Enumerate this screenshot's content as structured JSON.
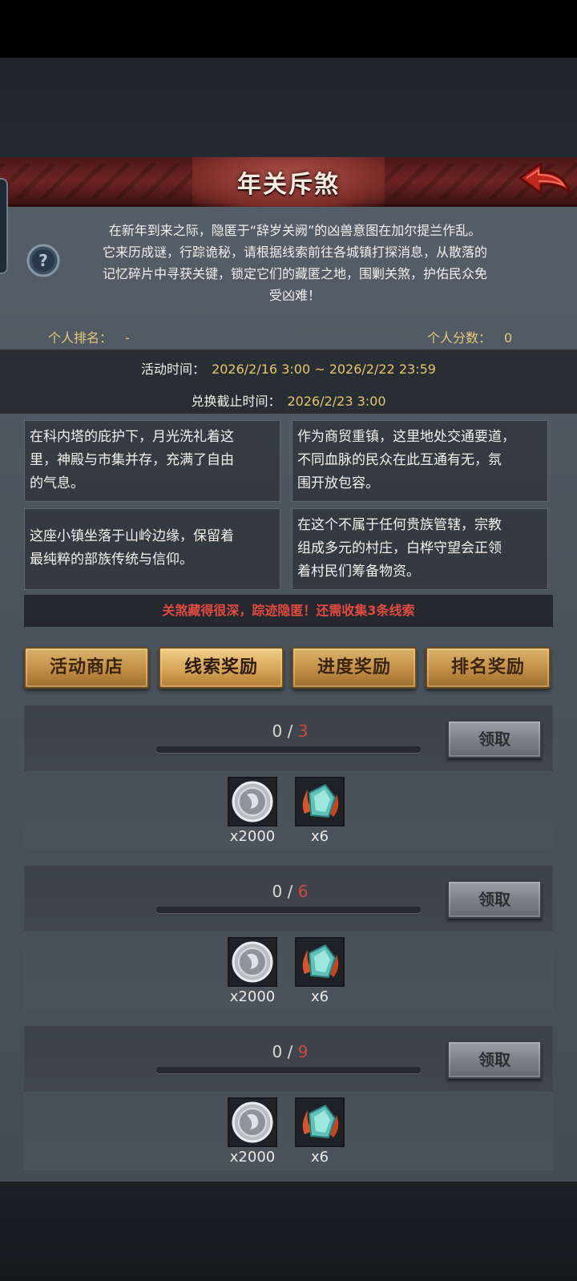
{
  "header": {
    "title": "年关斥煞"
  },
  "intro": {
    "lines": [
      "在新年到来之际，隐匿于“辞岁关阙”的凶兽意图在加尔提兰作乱。",
      "它来历成谜，行踪诡秘，请根据线索前往各城镇打探消息，从散落的",
      "记忆碎片中寻获关键，锁定它们的藏匿之地，围剿关煞，护佑民众免",
      "受凶难！"
    ]
  },
  "stats": {
    "rank_label": "个人排名：",
    "rank_value": "-",
    "score_label": "个人分数：",
    "score_value": "0"
  },
  "schedule": {
    "activity_label": "活动时间：",
    "activity_value": "2026/2/16 3:00 ~ 2026/2/22 23:59",
    "exchange_label": "兑换截止时间：",
    "exchange_value": "2026/2/23 3:00"
  },
  "clues": [
    {
      "lines": [
        "在科内塔的庇护下，月光洗礼着这",
        "里，神殿与市集并存，充满了自由",
        "的气息。"
      ]
    },
    {
      "lines": [
        "作为商贸重镇，这里地处交通要道，",
        "不同血脉的民众在此互通有无，氛",
        "围开放包容。"
      ]
    },
    {
      "lines": [
        "这座小镇坐落于山岭边缘，保留着",
        "最纯粹的部族传统与信仰。"
      ]
    },
    {
      "lines": [
        "在这个不属于任何贵族管辖，宗教",
        "组成多元的村庄，白桦守望会正领",
        "着村民们筹备物资。"
      ]
    }
  ],
  "warning": "关煞藏得很深，踪迹隐匿！还需收集3条线索",
  "tabs": [
    {
      "label": "活动商店",
      "active": false
    },
    {
      "label": "线索奖励",
      "active": true
    },
    {
      "label": "进度奖励",
      "active": false
    },
    {
      "label": "排名奖励",
      "active": false
    }
  ],
  "rewards": [
    {
      "current": "0",
      "sep": " / ",
      "goal": "3",
      "progress": 0,
      "claim_label": "领取",
      "items": [
        {
          "icon": "silver-coin-icon",
          "qty": "x2000"
        },
        {
          "icon": "crystal-shard-icon",
          "qty": "x6"
        }
      ]
    },
    {
      "current": "0",
      "sep": " / ",
      "goal": "6",
      "progress": 0,
      "claim_label": "领取",
      "items": [
        {
          "icon": "silver-coin-icon",
          "qty": "x2000"
        },
        {
          "icon": "crystal-shard-icon",
          "qty": "x6"
        }
      ]
    },
    {
      "current": "0",
      "sep": " / ",
      "goal": "9",
      "progress": 0,
      "claim_label": "领取",
      "items": [
        {
          "icon": "silver-coin-icon",
          "qty": "x2000"
        },
        {
          "icon": "crystal-shard-icon",
          "qty": "x6"
        }
      ]
    }
  ],
  "colors": {
    "title_bar": "#6d2422",
    "accent_gold": "#e6c777",
    "warning_red": "#e04a40",
    "tab_gold": "#c08e45"
  }
}
